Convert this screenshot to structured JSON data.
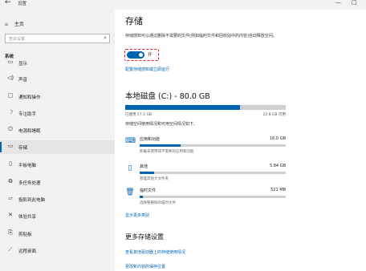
{
  "window": {
    "title": "设置",
    "back_glyph": "←",
    "min_glyph": "—",
    "max_glyph": "□"
  },
  "sidebar": {
    "home_label": "主页",
    "search_placeholder": "查找设置",
    "section_title": "系统",
    "items": [
      {
        "label": "显示",
        "icon": "monitor-icon",
        "glyph": "▭"
      },
      {
        "label": "声音",
        "icon": "speaker-icon",
        "glyph": "◁)"
      },
      {
        "label": "通知和操作",
        "icon": "notification-icon",
        "glyph": "▢"
      },
      {
        "label": "专注助手",
        "icon": "moon-icon",
        "glyph": "☽"
      },
      {
        "label": "电源和睡眠",
        "icon": "power-icon",
        "glyph": "⏻"
      },
      {
        "label": "存储",
        "icon": "storage-drive-icon",
        "glyph": "▭"
      },
      {
        "label": "平板电脑",
        "icon": "tablet-icon",
        "glyph": "▯"
      },
      {
        "label": "多任务处理",
        "icon": "multitasking-icon",
        "glyph": "⧉"
      },
      {
        "label": "投影到此电脑",
        "icon": "projector-icon",
        "glyph": "▱"
      },
      {
        "label": "体验共享",
        "icon": "share-icon",
        "glyph": "✕"
      },
      {
        "label": "剪贴板",
        "icon": "clipboard-icon",
        "glyph": "⎘"
      },
      {
        "label": "远程桌面",
        "icon": "remote-desktop-icon",
        "glyph": "⟋"
      }
    ],
    "active_index": 5
  },
  "main": {
    "title": "存储",
    "description": "存储感知可以通过删除不需要的文件(例如临时文件和回收站中的内容)自动释放空间。",
    "toggle_label": "开",
    "toggle_on": true,
    "configure_link": "配置存储感知或立即运行",
    "disk": {
      "title": "本地磁盘 (C:) - 80.0 GB",
      "used_label": "已使用 57.1 GB",
      "free_label": "22.8 GB 可用",
      "used_fraction": 0.714,
      "hint": "存储空间使用情况和可用空间情况如下。"
    },
    "categories": [
      {
        "name": "应用和功能",
        "size": "16.0 GB",
        "sub": "卸载未使用或不需要的应用和功能",
        "fraction": 0.28,
        "icon": "apps-icon",
        "glyph": "⌨"
      },
      {
        "name": "其他",
        "size": "5.84 GB",
        "sub": "管理其他大文件夹",
        "fraction": 0.1,
        "icon": "other-files-icon",
        "glyph": "▯"
      },
      {
        "name": "临时文件",
        "size": "521 MB",
        "sub": "选择要删除的临时文件",
        "fraction": 0.02,
        "icon": "trash-icon",
        "glyph": "🗑"
      }
    ],
    "show_more": "显示更多类别",
    "more_title": "更多存储设置",
    "more_links": [
      "查看其他驱动器上的存储使用情况",
      "更改新内容的保存位置"
    ]
  },
  "colors": {
    "accent": "#0063b1",
    "highlight_outline": "#e02020"
  }
}
